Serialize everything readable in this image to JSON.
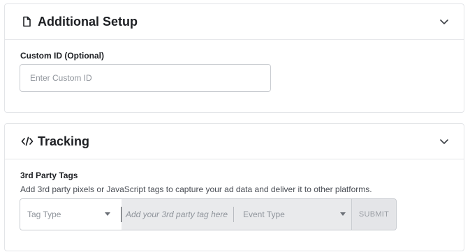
{
  "additional_setup": {
    "title": "Additional Setup",
    "icon": "document-icon",
    "custom_id": {
      "label": "Custom ID (Optional)",
      "placeholder": "Enter Custom ID",
      "value": ""
    }
  },
  "tracking": {
    "title": "Tracking",
    "icon": "code-icon",
    "third_party": {
      "label": "3rd Party Tags",
      "help": "Add 3rd party pixels or JavaScript tags to capture your ad data and deliver it to other platforms.",
      "tag_type_placeholder": "Tag Type",
      "tag_placeholder": "Add your 3rd party tag here",
      "event_type_placeholder": "Event Type",
      "submit_label": "SUBMIT"
    }
  },
  "colors": {
    "border": "#e3e5e8",
    "disabled_bg": "#e9eaec",
    "text": "#1d1f23",
    "muted": "#8f949b"
  }
}
